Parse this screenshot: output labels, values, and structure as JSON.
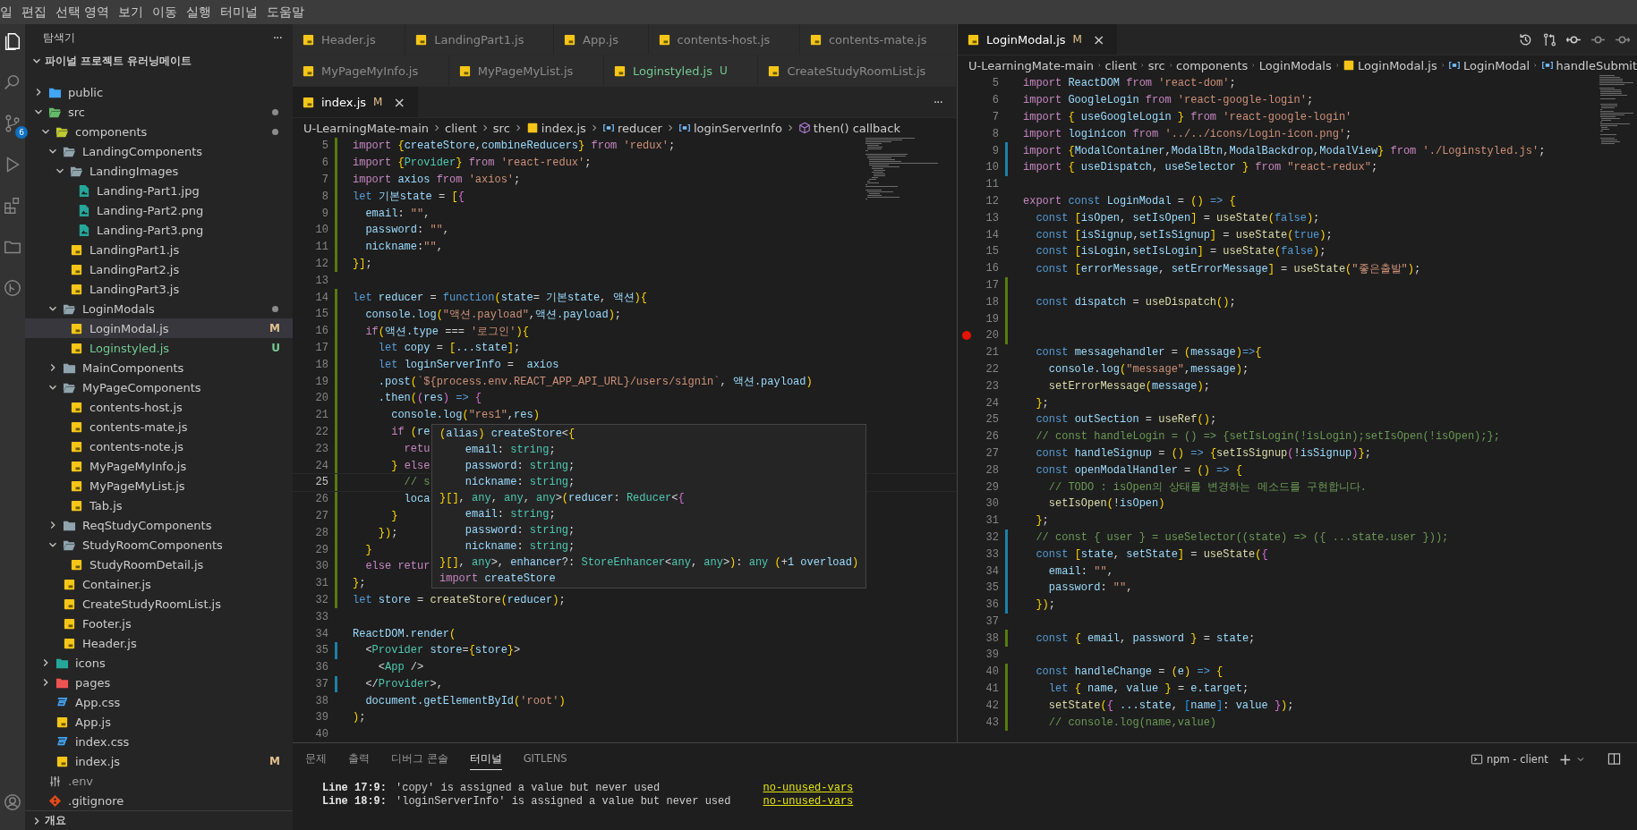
{
  "menu": [
    "일",
    "편집",
    "선택 영역",
    "보기",
    "이동",
    "실행",
    "터미널",
    "도움말"
  ],
  "activity": {
    "badge": "6"
  },
  "sidebar": {
    "title": "탐색기",
    "more": "···",
    "section": "파이널 프로젝트 유러닝메이트",
    "outline": "개요",
    "tree": [
      {
        "name": "public",
        "kind": "folder",
        "color": "#42a5f5",
        "expanded": false,
        "selected": false
      },
      {
        "name": "src",
        "kind": "folder",
        "color": "#66bb6a",
        "expanded": true,
        "dot": true,
        "selected": false,
        "children": [
          {
            "name": "components",
            "kind": "folder",
            "color": "#c0ca33",
            "expanded": true,
            "dot": true,
            "selected": false,
            "children": [
              {
                "name": "LandingComponents",
                "kind": "folder",
                "color": "#90a4ae",
                "expanded": true,
                "selected": false,
                "children": [
                  {
                    "name": "LandingImages",
                    "kind": "folder",
                    "color": "#90a4ae",
                    "expanded": true,
                    "selected": false,
                    "children": [
                      {
                        "name": "Landing-Part1.jpg",
                        "kind": "image",
                        "selected": false
                      },
                      {
                        "name": "Landing-Part2.png",
                        "kind": "image",
                        "selected": false
                      },
                      {
                        "name": "Landing-Part3.png",
                        "kind": "image",
                        "selected": false
                      }
                    ]
                  },
                  {
                    "name": "LandingPart1.js",
                    "kind": "js",
                    "selected": false
                  },
                  {
                    "name": "LandingPart2.js",
                    "kind": "js",
                    "selected": false
                  },
                  {
                    "name": "LandingPart3.js",
                    "kind": "js",
                    "selected": false
                  }
                ]
              },
              {
                "name": "LoginModals",
                "kind": "folder",
                "color": "#90a4ae",
                "expanded": true,
                "dot": true,
                "selected": false,
                "children": [
                  {
                    "name": "LoginModal.js",
                    "kind": "js",
                    "selected": true,
                    "badge": "M",
                    "untracked": false
                  },
                  {
                    "name": "Loginstyled.js",
                    "kind": "js",
                    "selected": false,
                    "badge": "U",
                    "untracked": true
                  }
                ]
              },
              {
                "name": "MainComponents",
                "kind": "folder",
                "color": "#90a4ae",
                "expanded": false,
                "selected": false
              },
              {
                "name": "MyPageComponents",
                "kind": "folder",
                "color": "#90a4ae",
                "expanded": true,
                "selected": false,
                "children": [
                  {
                    "name": "contents-host.js",
                    "kind": "js",
                    "selected": false
                  },
                  {
                    "name": "contents-mate.js",
                    "kind": "js",
                    "selected": false
                  },
                  {
                    "name": "contents-note.js",
                    "kind": "js",
                    "selected": false
                  },
                  {
                    "name": "MyPageMyInfo.js",
                    "kind": "js",
                    "selected": false
                  },
                  {
                    "name": "MyPageMyList.js",
                    "kind": "js",
                    "selected": false
                  },
                  {
                    "name": "Tab.js",
                    "kind": "js",
                    "selected": false
                  }
                ]
              },
              {
                "name": "ReqStudyComponents",
                "kind": "folder",
                "color": "#90a4ae",
                "expanded": false,
                "selected": false
              },
              {
                "name": "StudyRoomComponents",
                "kind": "folder",
                "color": "#90a4ae",
                "expanded": true,
                "selected": false,
                "children": [
                  {
                    "name": "StudyRoomDetail.js",
                    "kind": "js",
                    "selected": false
                  }
                ]
              },
              {
                "name": "Container.js",
                "kind": "js",
                "selected": false
              },
              {
                "name": "CreateStudyRoomList.js",
                "kind": "js",
                "selected": false
              },
              {
                "name": "Footer.js",
                "kind": "js",
                "selected": false
              },
              {
                "name": "Header.js",
                "kind": "js",
                "selected": false
              }
            ]
          },
          {
            "name": "icons",
            "kind": "folder",
            "color": "#26a69a",
            "expanded": false,
            "selected": false
          },
          {
            "name": "pages",
            "kind": "folder",
            "color": "#ef5350",
            "expanded": false,
            "selected": false
          },
          {
            "name": "App.css",
            "kind": "css",
            "selected": false
          },
          {
            "name": "App.js",
            "kind": "js",
            "selected": false
          },
          {
            "name": "index.css",
            "kind": "css",
            "selected": false
          },
          {
            "name": "index.js",
            "kind": "js",
            "selected": false,
            "badge": "M",
            "untracked": false
          }
        ]
      },
      {
        "name": ".env",
        "kind": "env",
        "selected": false
      },
      {
        "name": ".gitignore",
        "kind": "git",
        "selected": false
      }
    ]
  },
  "left": {
    "tab_rows": [
      [
        {
          "label": "Header.js",
          "selected": false
        },
        {
          "label": "LandingPart1.js",
          "selected": false
        },
        {
          "label": "App.js",
          "selected": false
        },
        {
          "label": "contents-host.js",
          "selected": false
        },
        {
          "label": "contents-mate.js",
          "selected": false
        }
      ],
      [
        {
          "label": "MyPageMyInfo.js",
          "selected": false
        },
        {
          "label": "MyPageMyList.js",
          "selected": false
        },
        {
          "label": "Loginstyled.js",
          "selected": false,
          "badge": "U",
          "untracked": true
        },
        {
          "label": "CreateStudyRoomList.js",
          "selected": false
        }
      ],
      [
        {
          "label": "index.js",
          "selected": true,
          "badge": "M",
          "untracked": false,
          "close": "×"
        }
      ]
    ],
    "more": "···",
    "breadcrumb": [
      {
        "text": "U-LearningMate-main",
        "kind": "folder"
      },
      {
        "text": "client",
        "kind": "folder"
      },
      {
        "text": "src",
        "kind": "folder"
      },
      {
        "text": "index.js",
        "kind": "file"
      },
      {
        "text": "reducer",
        "kind": "variable"
      },
      {
        "text": "loginServerInfo",
        "kind": "variable"
      },
      {
        "text": "then() callback",
        "kind": "method"
      }
    ],
    "lines": [
      {
        "n": "5",
        "added": true,
        "t": "import {createStore,combineReducers} from 'redux';"
      },
      {
        "n": "6",
        "added": true,
        "t": "import {Provider} from 'react-redux';"
      },
      {
        "n": "7",
        "added": true,
        "t": "import axios from 'axios';"
      },
      {
        "n": "8",
        "added": true,
        "t": "let 기본state = [{"
      },
      {
        "n": "9",
        "added": true,
        "t": "  email: \"\","
      },
      {
        "n": "10",
        "added": true,
        "t": "  password: \"\","
      },
      {
        "n": "11",
        "added": true,
        "t": "  nickname:\"\","
      },
      {
        "n": "12",
        "added": true,
        "t": "}];"
      },
      {
        "n": "13"
      },
      {
        "n": "14",
        "added": true,
        "t": "let reducer = function(state= 기본state, 액션){"
      },
      {
        "n": "15",
        "added": true,
        "t": "  console.log(\"액션.payload\",액션.payload);"
      },
      {
        "n": "16",
        "added": true,
        "t": "  if(액션.type === '로그인'){"
      },
      {
        "n": "17",
        "added": true,
        "t": "    let copy = [...state];"
      },
      {
        "n": "18",
        "added": true,
        "t": "    let loginServerInfo =  axios"
      },
      {
        "n": "19",
        "added": true,
        "t": "    .post(`${process.env.REACT_APP_API_URL}/users/signin`, 액션.payload)"
      },
      {
        "n": "20",
        "added": true,
        "t": "    .then((res) => {"
      },
      {
        "n": "21",
        "added": true,
        "t": "      console.log(\"res1\",res)"
      },
      {
        "n": "22",
        "added": true,
        "t": "      if (re"
      },
      {
        "n": "23",
        "added": true,
        "t": "        retu"
      },
      {
        "n": "24",
        "added": true,
        "t": "      } else"
      },
      {
        "n": "25",
        "added": true,
        "current": true,
        "t": "        // s"
      },
      {
        "n": "26",
        "added": true,
        "t": "        loca"
      },
      {
        "n": "27",
        "added": true,
        "t": "      }"
      },
      {
        "n": "28",
        "added": true,
        "t": "    });"
      },
      {
        "n": "29",
        "added": true,
        "t": "  }"
      },
      {
        "n": "30",
        "added": true,
        "t": "  else retur"
      },
      {
        "n": "31",
        "added": true,
        "t": "};"
      },
      {
        "n": "32",
        "added": true,
        "t": "let store = createStore(reducer);"
      },
      {
        "n": "33"
      },
      {
        "n": "34",
        "t": "ReactDOM.render("
      },
      {
        "n": "35",
        "added": false,
        "t": "  <Provider store={store}>"
      },
      {
        "n": "36",
        "t": "    <App />"
      },
      {
        "n": "37",
        "added": false,
        "t": "  </Provider>,"
      },
      {
        "n": "38",
        "t": "  document.getElementById('root')"
      },
      {
        "n": "39",
        "t": ");"
      },
      {
        "n": "40"
      }
    ],
    "tooltip": [
      "(alias) createStore<{",
      "    email: string;",
      "    password: string;",
      "    nickname: string;",
      "}[], any, any, any>(reducer: Reducer<{",
      "    email: string;",
      "    password: string;",
      "    nickname: string;",
      "}[], any>, enhancer?: StoreEnhancer<any, any>): any (+1 overload)",
      "import createStore"
    ]
  },
  "right": {
    "tab": {
      "label": "LoginModal.js",
      "selected": true,
      "badge": "M",
      "untracked": false,
      "close": "×"
    },
    "breadcrumb": [
      {
        "text": "U-LearningMate-main",
        "kind": "folder"
      },
      {
        "text": "client",
        "kind": "folder"
      },
      {
        "text": "src",
        "kind": "folder"
      },
      {
        "text": "components",
        "kind": "folder"
      },
      {
        "text": "LoginModals",
        "kind": "folder"
      },
      {
        "text": "LoginModal.js",
        "kind": "file"
      },
      {
        "text": "LoginModal",
        "kind": "variable"
      },
      {
        "text": "handleSubmit",
        "kind": "variable"
      }
    ],
    "lines": [
      {
        "n": "5",
        "t": "import ReactDOM from 'react-dom';"
      },
      {
        "n": "6",
        "t": "import GoogleLogin from 'react-google-login';"
      },
      {
        "n": "7",
        "t": "import { useGoogleLogin } from 'react-google-login'"
      },
      {
        "n": "8",
        "t": "import loginicon from '../../icons/Login-icon.png';"
      },
      {
        "n": "9",
        "added": false,
        "t": "import {ModalContainer,ModalBtn,ModalBackdrop,ModalView} from './Loginstyled.js';"
      },
      {
        "n": "10",
        "added": false,
        "t": "import { useDispatch, useSelector } from \"react-redux\";"
      },
      {
        "n": "11"
      },
      {
        "n": "12",
        "t": "export const LoginModal = () => {"
      },
      {
        "n": "13",
        "t": "  const [isOpen, setIsOpen] = useState(false);"
      },
      {
        "n": "14",
        "t": "  const [isSignup,setIsSignup] = useState(true);"
      },
      {
        "n": "15",
        "t": "  const [isLogin,setIsLogin] = useState(false);"
      },
      {
        "n": "16",
        "t": "  const [errorMessage, setErrorMessage] = useState(\"좋은출발\");"
      },
      {
        "n": "17",
        "added": true
      },
      {
        "n": "18",
        "added": true,
        "t": "  const dispatch = useDispatch();"
      },
      {
        "n": "19",
        "added": true
      },
      {
        "n": "20",
        "added": true,
        "breakpoint": true
      },
      {
        "n": "21",
        "t": "  const messagehandler = (message)=>{"
      },
      {
        "n": "22",
        "t": "    console.log(\"message\",message);"
      },
      {
        "n": "23",
        "t": "    setErrorMessage(message);"
      },
      {
        "n": "24",
        "t": "  };"
      },
      {
        "n": "25",
        "t": "  const outSection = useRef();"
      },
      {
        "n": "26",
        "t": "  // const handleLogin = () => {setIsLogin(!isLogin);setIsOpen(!isOpen);};"
      },
      {
        "n": "27",
        "t": "  const handleSignup = () => {setIsSignup(!isSignup)};"
      },
      {
        "n": "28",
        "t": "  const openModalHandler = () => {"
      },
      {
        "n": "29",
        "t": "    // TODO : isOpen의 상태를 변경하는 메소드를 구현합니다."
      },
      {
        "n": "30",
        "t": "    setIsOpen(!isOpen)"
      },
      {
        "n": "31",
        "t": "  };"
      },
      {
        "n": "32",
        "added": false,
        "t": "  // const { user } = useSelector((state) => ({ ...state.user }));"
      },
      {
        "n": "33",
        "added": false,
        "t": "  const [state, setState] = useState({"
      },
      {
        "n": "34",
        "added": false,
        "t": "    email: \"\","
      },
      {
        "n": "35",
        "added": false,
        "t": "    password: \"\","
      },
      {
        "n": "36",
        "added": false,
        "t": "  });"
      },
      {
        "n": "37"
      },
      {
        "n": "38",
        "added": true,
        "t": "  const { email, password } = state;"
      },
      {
        "n": "39"
      },
      {
        "n": "40",
        "added": true,
        "t": "  const handleChange = (e) => {"
      },
      {
        "n": "41",
        "added": true,
        "t": "    let { name, value } = e.target;"
      },
      {
        "n": "42",
        "added": true,
        "t": "    setState({ ...state, [name]: value });"
      },
      {
        "n": "43",
        "added": true,
        "t": "    // console.log(name,value)"
      }
    ]
  },
  "panel": {
    "tabs": [
      {
        "label": "문제",
        "selected": false
      },
      {
        "label": "출력",
        "selected": false
      },
      {
        "label": "디버그 콘솔",
        "selected": false
      },
      {
        "label": "터미널",
        "selected": true
      },
      {
        "label": "GITLENS",
        "selected": false
      }
    ],
    "terminal_name": "npm - client",
    "add": "+",
    "lines": [
      {
        "loc": "Line 17:9:",
        "msg": "'copy' is assigned a value but never used",
        "rule": "no-unused-vars"
      },
      {
        "loc": "Line 18:9:",
        "msg": "'loginServerInfo' is assigned a value but never used",
        "rule": "no-unused-vars"
      }
    ]
  }
}
